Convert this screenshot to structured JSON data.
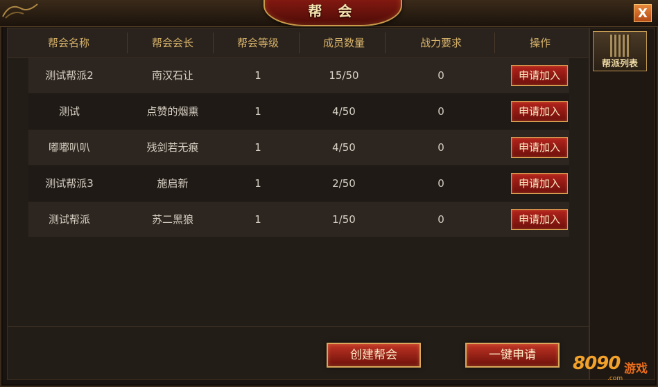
{
  "window": {
    "title": "帮 会",
    "close_label": "X"
  },
  "sidebar": {
    "tab_label": "帮派列表"
  },
  "table": {
    "headers": [
      "帮会名称",
      "帮会会长",
      "帮会等级",
      "成员数量",
      "战力要求",
      "操作"
    ],
    "rows": [
      {
        "name": "测试帮派2",
        "leader": "南汉石让",
        "level": "1",
        "members": "15/50",
        "power": "0",
        "action": "申请加入"
      },
      {
        "name": "测试",
        "leader": "点赞的烟熏",
        "level": "1",
        "members": "4/50",
        "power": "0",
        "action": "申请加入"
      },
      {
        "name": "嘟嘟叭叭",
        "leader": "残剑若无痕",
        "level": "1",
        "members": "4/50",
        "power": "0",
        "action": "申请加入"
      },
      {
        "name": "测试帮派3",
        "leader": "施启新",
        "level": "1",
        "members": "2/50",
        "power": "0",
        "action": "申请加入"
      },
      {
        "name": "测试帮派",
        "leader": "苏二黑狼",
        "level": "1",
        "members": "1/50",
        "power": "0",
        "action": "申请加入"
      }
    ]
  },
  "footer": {
    "create_label": "创建帮会",
    "quick_apply_label": "一键申请"
  },
  "watermark": {
    "number": "8090",
    "text": "游戏",
    "domain": ".com"
  },
  "colors": {
    "accent_gold": "#d8b36a",
    "button_red": "#b3231c",
    "panel_bg": "#231d18"
  }
}
